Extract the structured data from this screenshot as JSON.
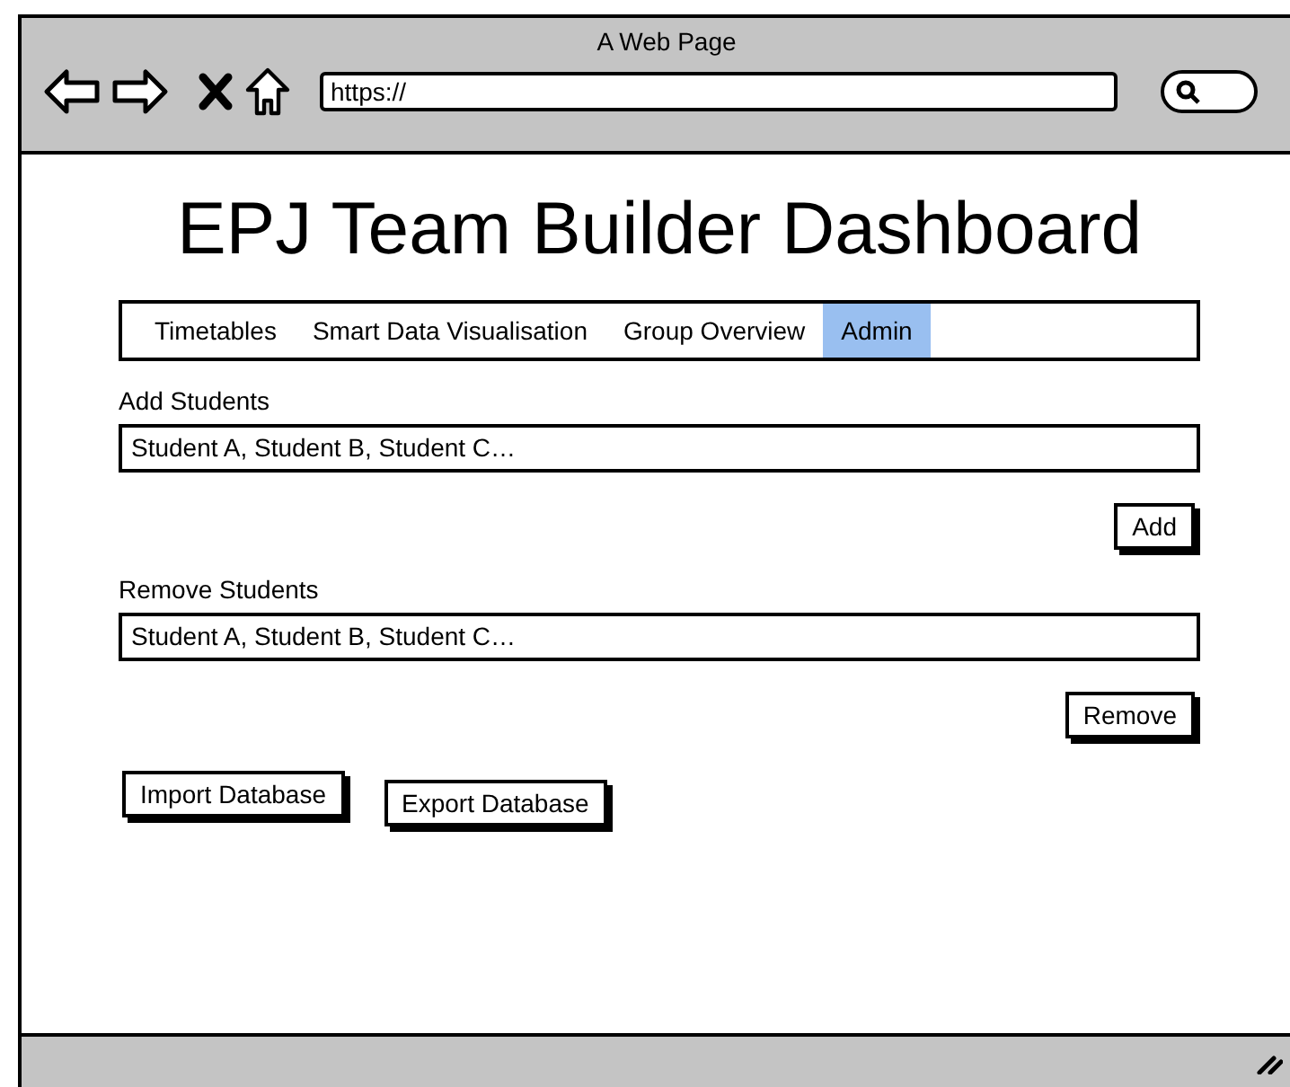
{
  "window": {
    "title": "A Web Page",
    "address": "https://"
  },
  "heading": "EPJ Team Builder Dashboard",
  "tabs": [
    {
      "label": "Timetables",
      "selected": false
    },
    {
      "label": "Smart Data Visualisation",
      "selected": false
    },
    {
      "label": "Group Overview",
      "selected": false
    },
    {
      "label": "Admin",
      "selected": true
    }
  ],
  "sections": [
    {
      "label": "Add Students",
      "value": "Student A, Student B, Student C…",
      "button": "Add"
    },
    {
      "label": "Remove Students",
      "value": "Student A, Student B, Student C…",
      "button": "Remove"
    }
  ],
  "buttons": [
    "Import Database",
    "Export Database"
  ]
}
